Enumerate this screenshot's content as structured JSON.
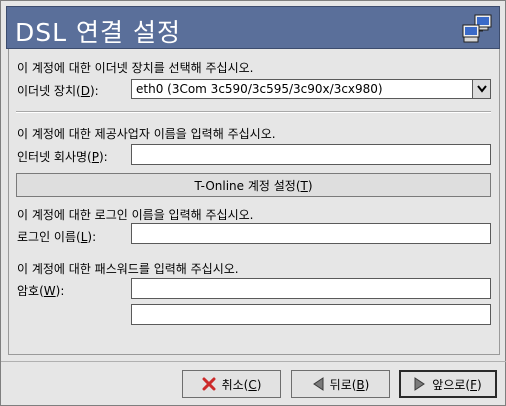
{
  "window": {
    "title": "DSL 연결 설정"
  },
  "device_section": {
    "instruction": "이 계정에 대한 이더넷 장치를 선택해 주십시오.",
    "label_prefix": "이더넷 장치(",
    "label_mnemonic": "D",
    "label_suffix": "):",
    "selected_value": "eth0 (3Com 3c590/3c595/3c90x/3cx980)"
  },
  "provider_section": {
    "instruction": "이 계정에 대한 제공사업자 이름을 입력해 주십시오.",
    "label_prefix": "인터넷 회사명(",
    "label_mnemonic": "P",
    "label_suffix": "):",
    "value": ""
  },
  "tonline_button": {
    "label_prefix": "T-Online 계정 설정(",
    "label_mnemonic": "T",
    "label_suffix": ")"
  },
  "login_section": {
    "instruction": "이 계정에 대한 로그인 이름을 입력해 주십시오.",
    "label_prefix": "로그인 이름(",
    "label_mnemonic": "L",
    "label_suffix": "):",
    "value": ""
  },
  "password_section": {
    "instruction": "이 계정에 대한 패스워드를 입력해 주십시오.",
    "label_prefix": "암호(",
    "label_mnemonic": "W",
    "label_suffix": "):",
    "value": "",
    "confirm_value": ""
  },
  "buttons": {
    "cancel": {
      "prefix": "취소(",
      "mnemonic": "C",
      "suffix": ")",
      "icon": "x-icon",
      "icon_color": "#cc2a2a"
    },
    "back": {
      "prefix": "뒤로(",
      "mnemonic": "B",
      "suffix": ")",
      "icon": "left-arrow-icon"
    },
    "forward": {
      "prefix": "앞으로(",
      "mnemonic": "F",
      "suffix": ")",
      "icon": "right-arrow-icon"
    }
  },
  "colors": {
    "header_bg": "#5a6f9a",
    "window_bg": "#e6e6e6"
  }
}
